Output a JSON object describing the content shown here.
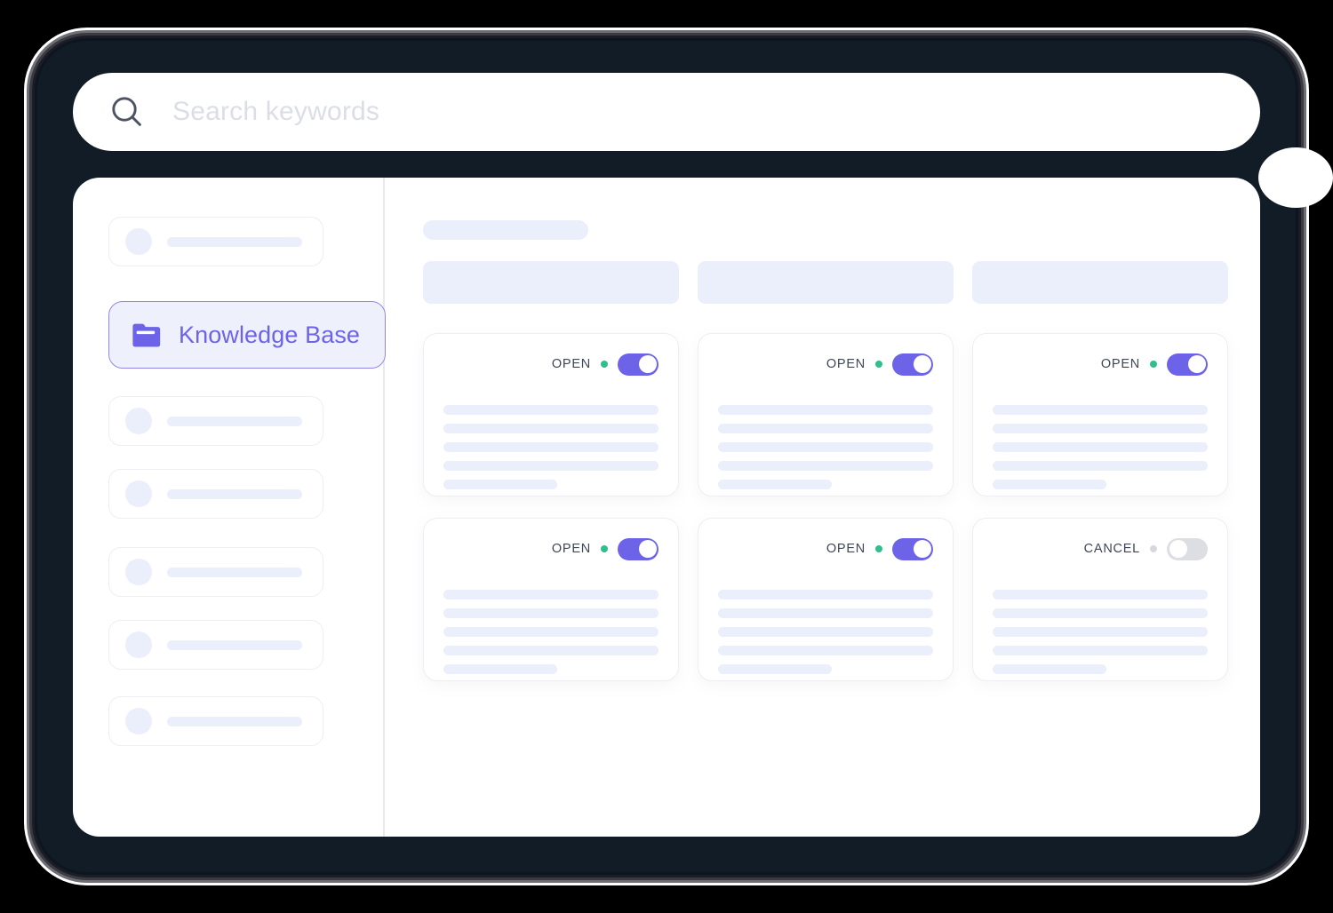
{
  "app": {
    "frame_color": "#111c26",
    "accent_color": "#6c63e8",
    "skeleton_color": "#ebeefb",
    "status_on_color": "#2fbf8f",
    "status_off_color": "#d6d8dd"
  },
  "search": {
    "icon": "search-icon",
    "placeholder": "Search keywords",
    "value": ""
  },
  "sidebar": {
    "items_above": [
      {
        "type": "skeleton",
        "label": ""
      }
    ],
    "active_item": {
      "icon": "folder-icon",
      "label": "Knowledge Base"
    },
    "items_below": [
      {
        "type": "skeleton",
        "label": ""
      },
      {
        "type": "skeleton",
        "label": ""
      },
      {
        "type": "skeleton",
        "label": ""
      },
      {
        "type": "skeleton",
        "label": ""
      },
      {
        "type": "skeleton",
        "label": ""
      }
    ]
  },
  "main": {
    "title_placeholder": "",
    "filters": [
      {
        "label": ""
      },
      {
        "label": ""
      },
      {
        "label": ""
      }
    ],
    "cards": [
      {
        "status": "OPEN",
        "toggle": "on",
        "lines": 5
      },
      {
        "status": "OPEN",
        "toggle": "on",
        "lines": 5
      },
      {
        "status": "OPEN",
        "toggle": "on",
        "lines": 5
      },
      {
        "status": "OPEN",
        "toggle": "on",
        "lines": 5
      },
      {
        "status": "OPEN",
        "toggle": "on",
        "lines": 5
      },
      {
        "status": "CANCEL",
        "toggle": "off",
        "lines": 5
      }
    ]
  }
}
